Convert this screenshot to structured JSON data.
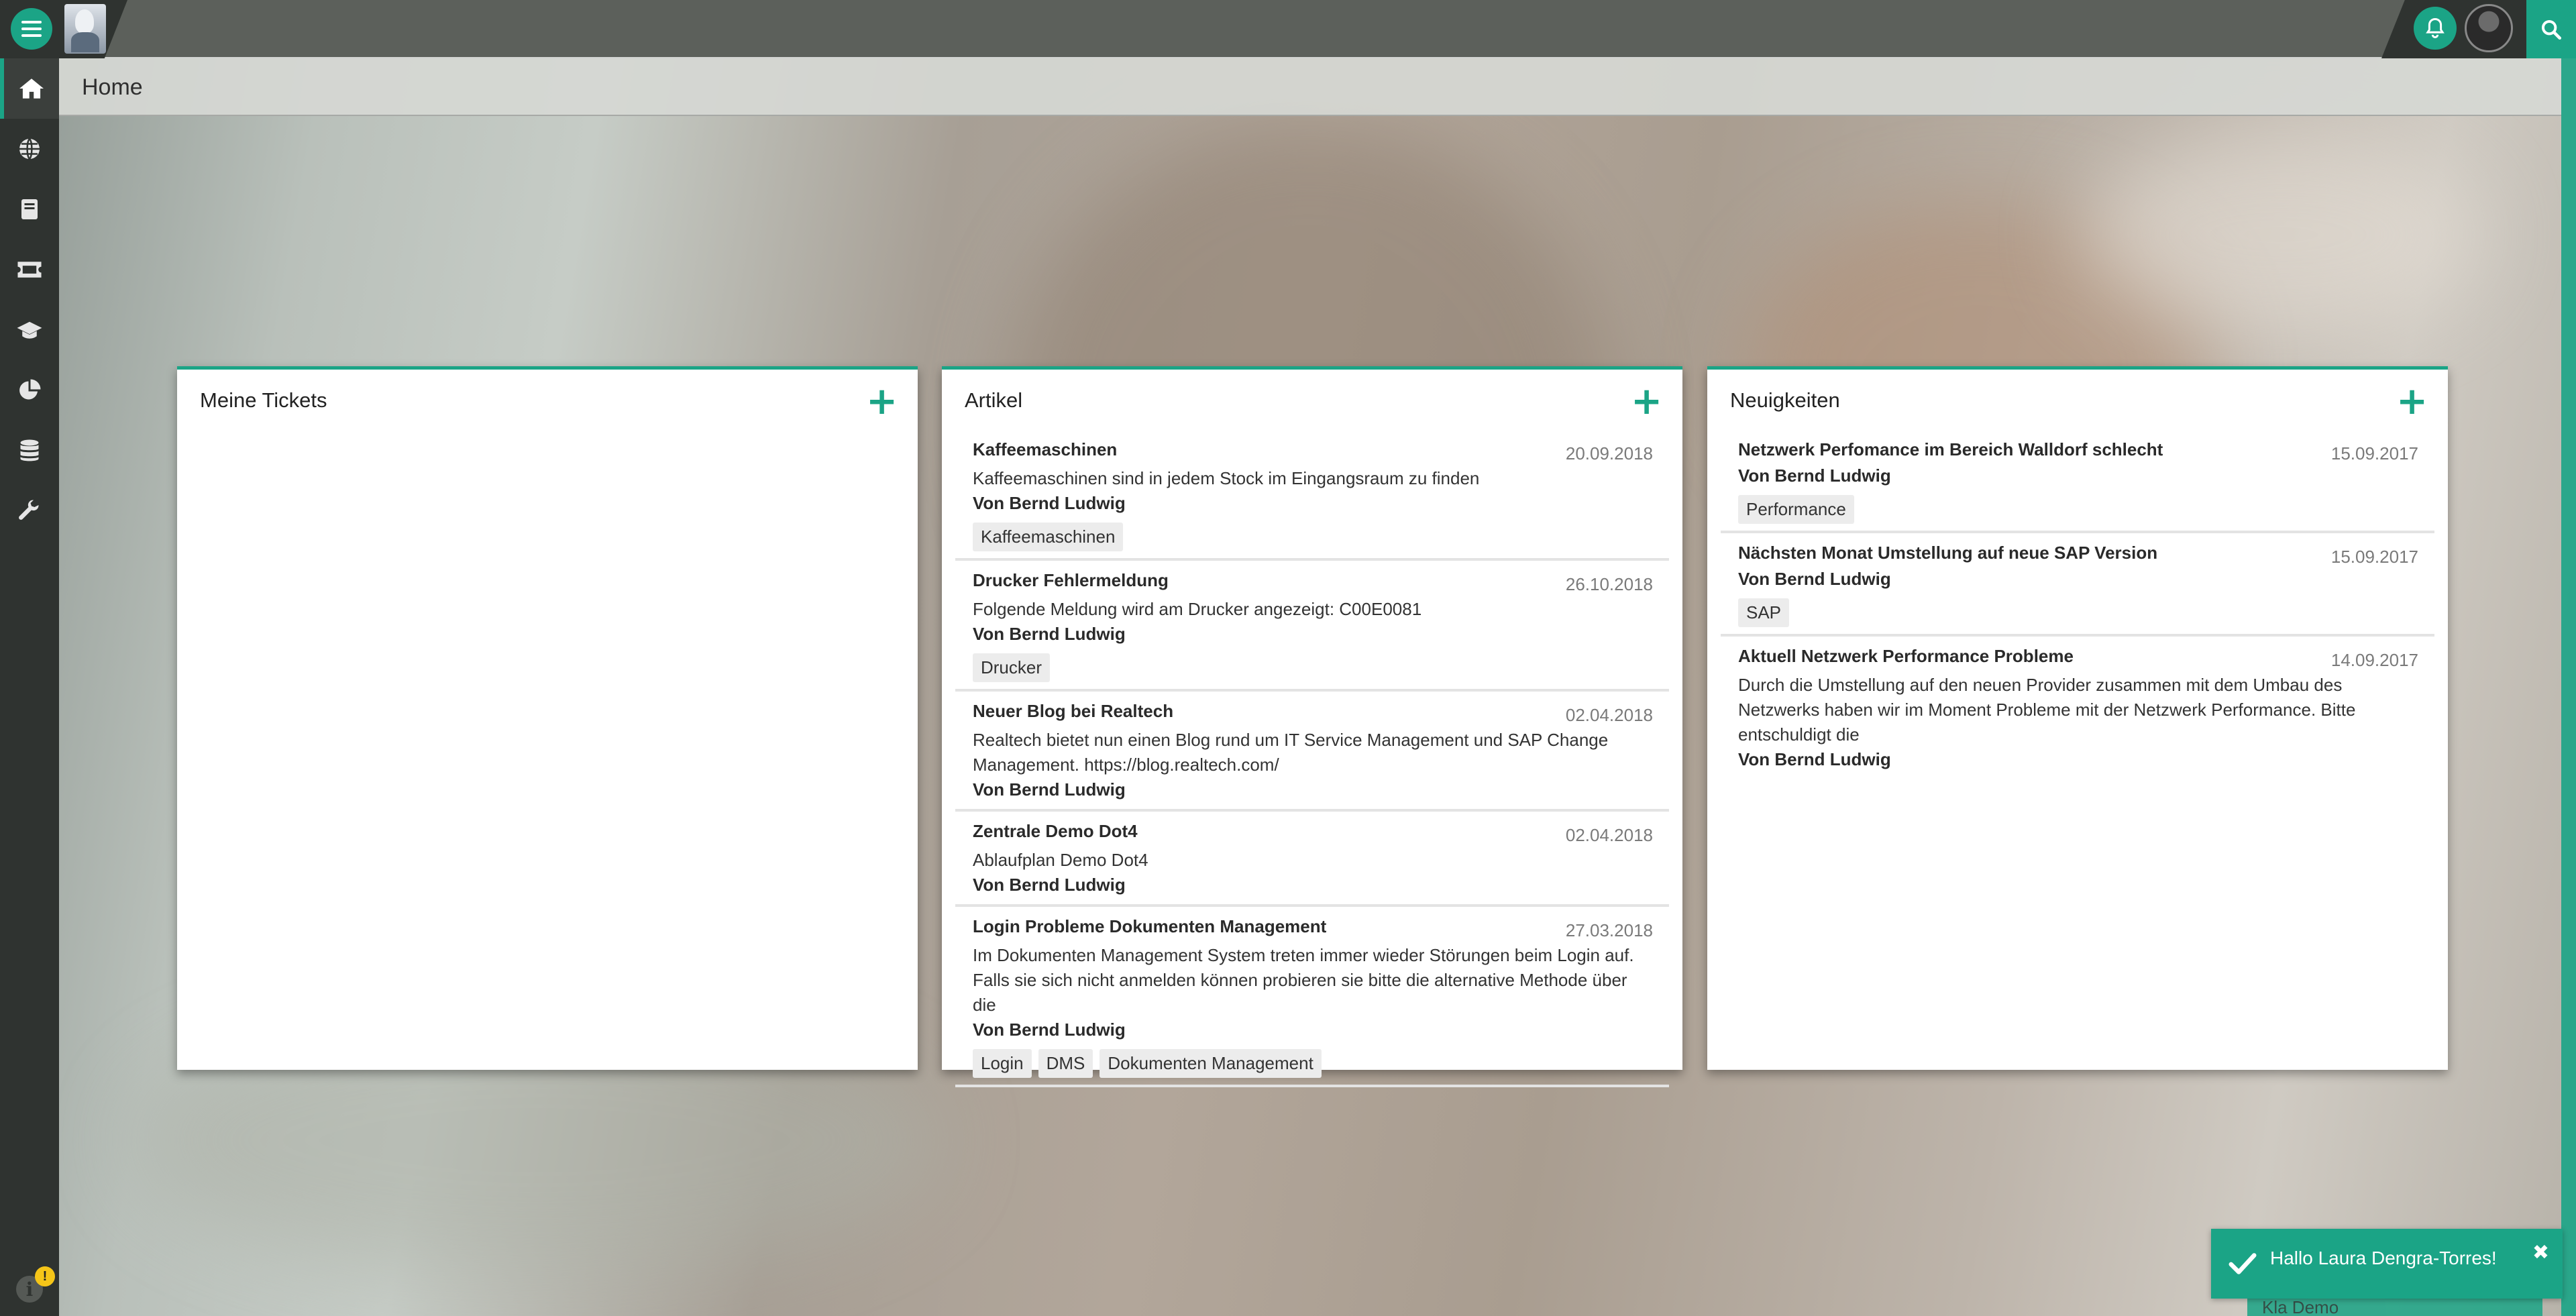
{
  "app": {
    "page_title": "Home"
  },
  "colors": {
    "accent": "#1ba486",
    "sidebar": "#2f3330",
    "topbar": "#5c605b"
  },
  "sidebar": {
    "items": [
      {
        "icon": "home-icon",
        "active": true
      },
      {
        "icon": "globe-icon",
        "active": false
      },
      {
        "icon": "book-icon",
        "active": false
      },
      {
        "icon": "ticket-icon",
        "active": false
      },
      {
        "icon": "graduation-cap-icon",
        "active": false
      },
      {
        "icon": "pie-chart-icon",
        "active": false
      },
      {
        "icon": "database-icon",
        "active": false
      },
      {
        "icon": "wrench-icon",
        "active": false
      }
    ],
    "info_badge": "!"
  },
  "cards": {
    "tickets": {
      "title": "Meine Tickets"
    },
    "articles": {
      "title": "Artikel",
      "items": [
        {
          "title": "Kaffeemaschinen",
          "date": "20.09.2018",
          "text": "Kaffeemaschinen sind in jedem Stock im Eingangsraum zu finden",
          "author": "Von Bernd Ludwig",
          "tags": [
            "Kaffeemaschinen"
          ]
        },
        {
          "title": "Drucker Fehlermeldung",
          "date": "26.10.2018",
          "text": "Folgende Meldung wird am Drucker angezeigt: C00E0081",
          "author": "Von Bernd Ludwig",
          "tags": [
            "Drucker"
          ]
        },
        {
          "title": "Neuer Blog bei Realtech",
          "date": "02.04.2018",
          "text": "Realtech bietet nun einen Blog rund um IT Service Management und SAP Change Management. https://blog.realtech.com/",
          "author": "Von Bernd Ludwig",
          "tags": []
        },
        {
          "title": "Zentrale Demo Dot4",
          "date": "02.04.2018",
          "text": "Ablaufplan Demo Dot4",
          "author": "Von Bernd Ludwig",
          "tags": []
        },
        {
          "title": "Login Probleme Dokumenten Management",
          "date": "27.03.2018",
          "text": "Im Dokumenten Management System treten immer wieder Störungen beim Login auf. Falls sie sich nicht anmelden können probieren sie bitte die alternative Methode über die",
          "author": "Von Bernd Ludwig",
          "tags": [
            "Login",
            "DMS",
            "Dokumenten Management"
          ]
        }
      ]
    },
    "news": {
      "title": "Neuigkeiten",
      "items": [
        {
          "title": "Netzwerk Perfomance im Bereich Walldorf schlecht",
          "date": "15.09.2017",
          "text": "",
          "author": "Von Bernd Ludwig",
          "tags": [
            "Performance"
          ]
        },
        {
          "title": "Nächsten Monat Umstellung auf neue SAP Version",
          "date": "15.09.2017",
          "text": "",
          "author": "Von Bernd Ludwig",
          "tags": [
            "SAP"
          ]
        },
        {
          "title": "Aktuell Netzwerk Performance Probleme",
          "date": "14.09.2017",
          "text": "Durch die Umstellung auf den neuen Provider zusammen mit dem Umbau des Netzwerks haben wir im Moment Probleme mit der Netzwerk Performance. Bitte entschuldigt die",
          "author": "Von Bernd Ludwig",
          "tags": []
        }
      ]
    }
  },
  "toast": {
    "message": "Hallo Laura Dengra-Torres!",
    "under_text": "Kla Demo"
  }
}
